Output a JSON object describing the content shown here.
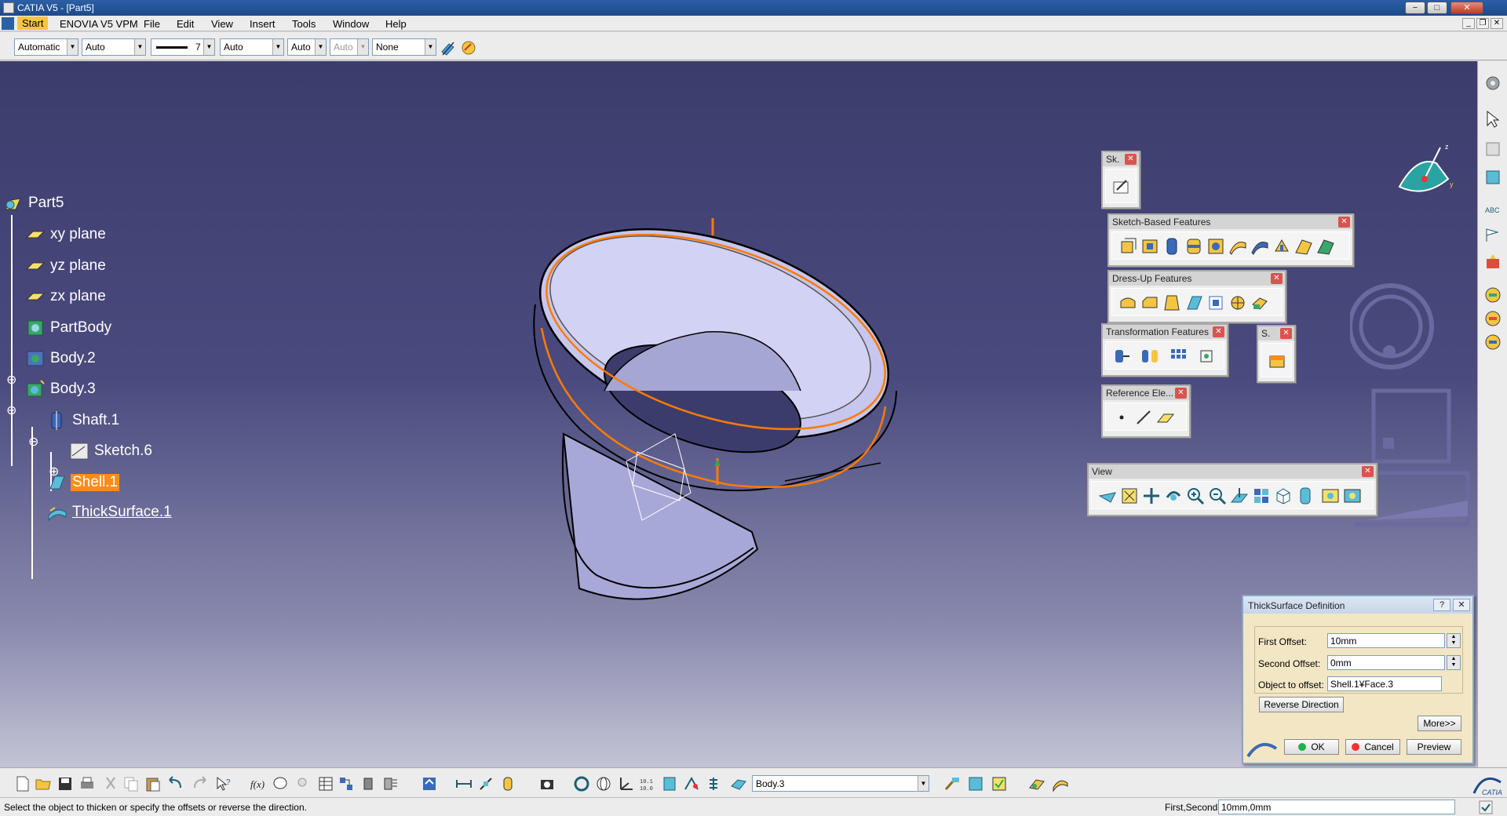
{
  "window": {
    "title": "CATIA V5 - [Part5]",
    "minimize": "−",
    "maximize": "□",
    "close": "✕"
  },
  "menu": {
    "items": [
      "Start",
      "ENOVIA V5 VPM",
      "File",
      "Edit",
      "View",
      "Insert",
      "Tools",
      "Window",
      "Help"
    ]
  },
  "graphic_properties": {
    "color": "Automatic",
    "transparency": "Auto",
    "line_weight": "7",
    "line_type": "Auto",
    "point_type": "Auto",
    "layer_disabled": "Auto",
    "layer": "None"
  },
  "tree": {
    "root": "Part5",
    "nodes": [
      "xy plane",
      "yz plane",
      "zx plane",
      "PartBody",
      "Body.2",
      "Body.3",
      "Shaft.1",
      "Sketch.6",
      "Shell.1",
      "ThickSurface.1"
    ]
  },
  "toolbars": {
    "sketcher": "Sk.",
    "sketch_based": "Sketch-Based Features",
    "dress_up": "Dress-Up Features",
    "transformation": "Transformation Features",
    "surface_small": "S.",
    "reference": "Reference Ele...",
    "view": "View"
  },
  "dialog": {
    "title": "ThickSurface Definition",
    "help": "?",
    "close": "✕",
    "first_offset_label": "First Offset:",
    "first_offset_value": "10mm",
    "second_offset_label": "Second Offset:",
    "second_offset_value": "0mm",
    "object_label": "Object to offset:",
    "object_value": "Shell.1¥Face.3",
    "reverse_button": "Reverse Direction",
    "more_button": "More>>",
    "ok_button": "OK",
    "cancel_button": "Cancel",
    "preview_button": "Preview"
  },
  "bottom_toolbar": {
    "current_body": "Body.3"
  },
  "statusbar": {
    "message": "Select the object to thicken or specify the offsets or reverse the direction.",
    "field_label": "First,Second",
    "field_value": "10mm,0mm"
  },
  "colors": {
    "selection": "#ff8c1a",
    "viewport_top": "#3c3c6c",
    "dialog_bg": "#f2e6c4"
  }
}
